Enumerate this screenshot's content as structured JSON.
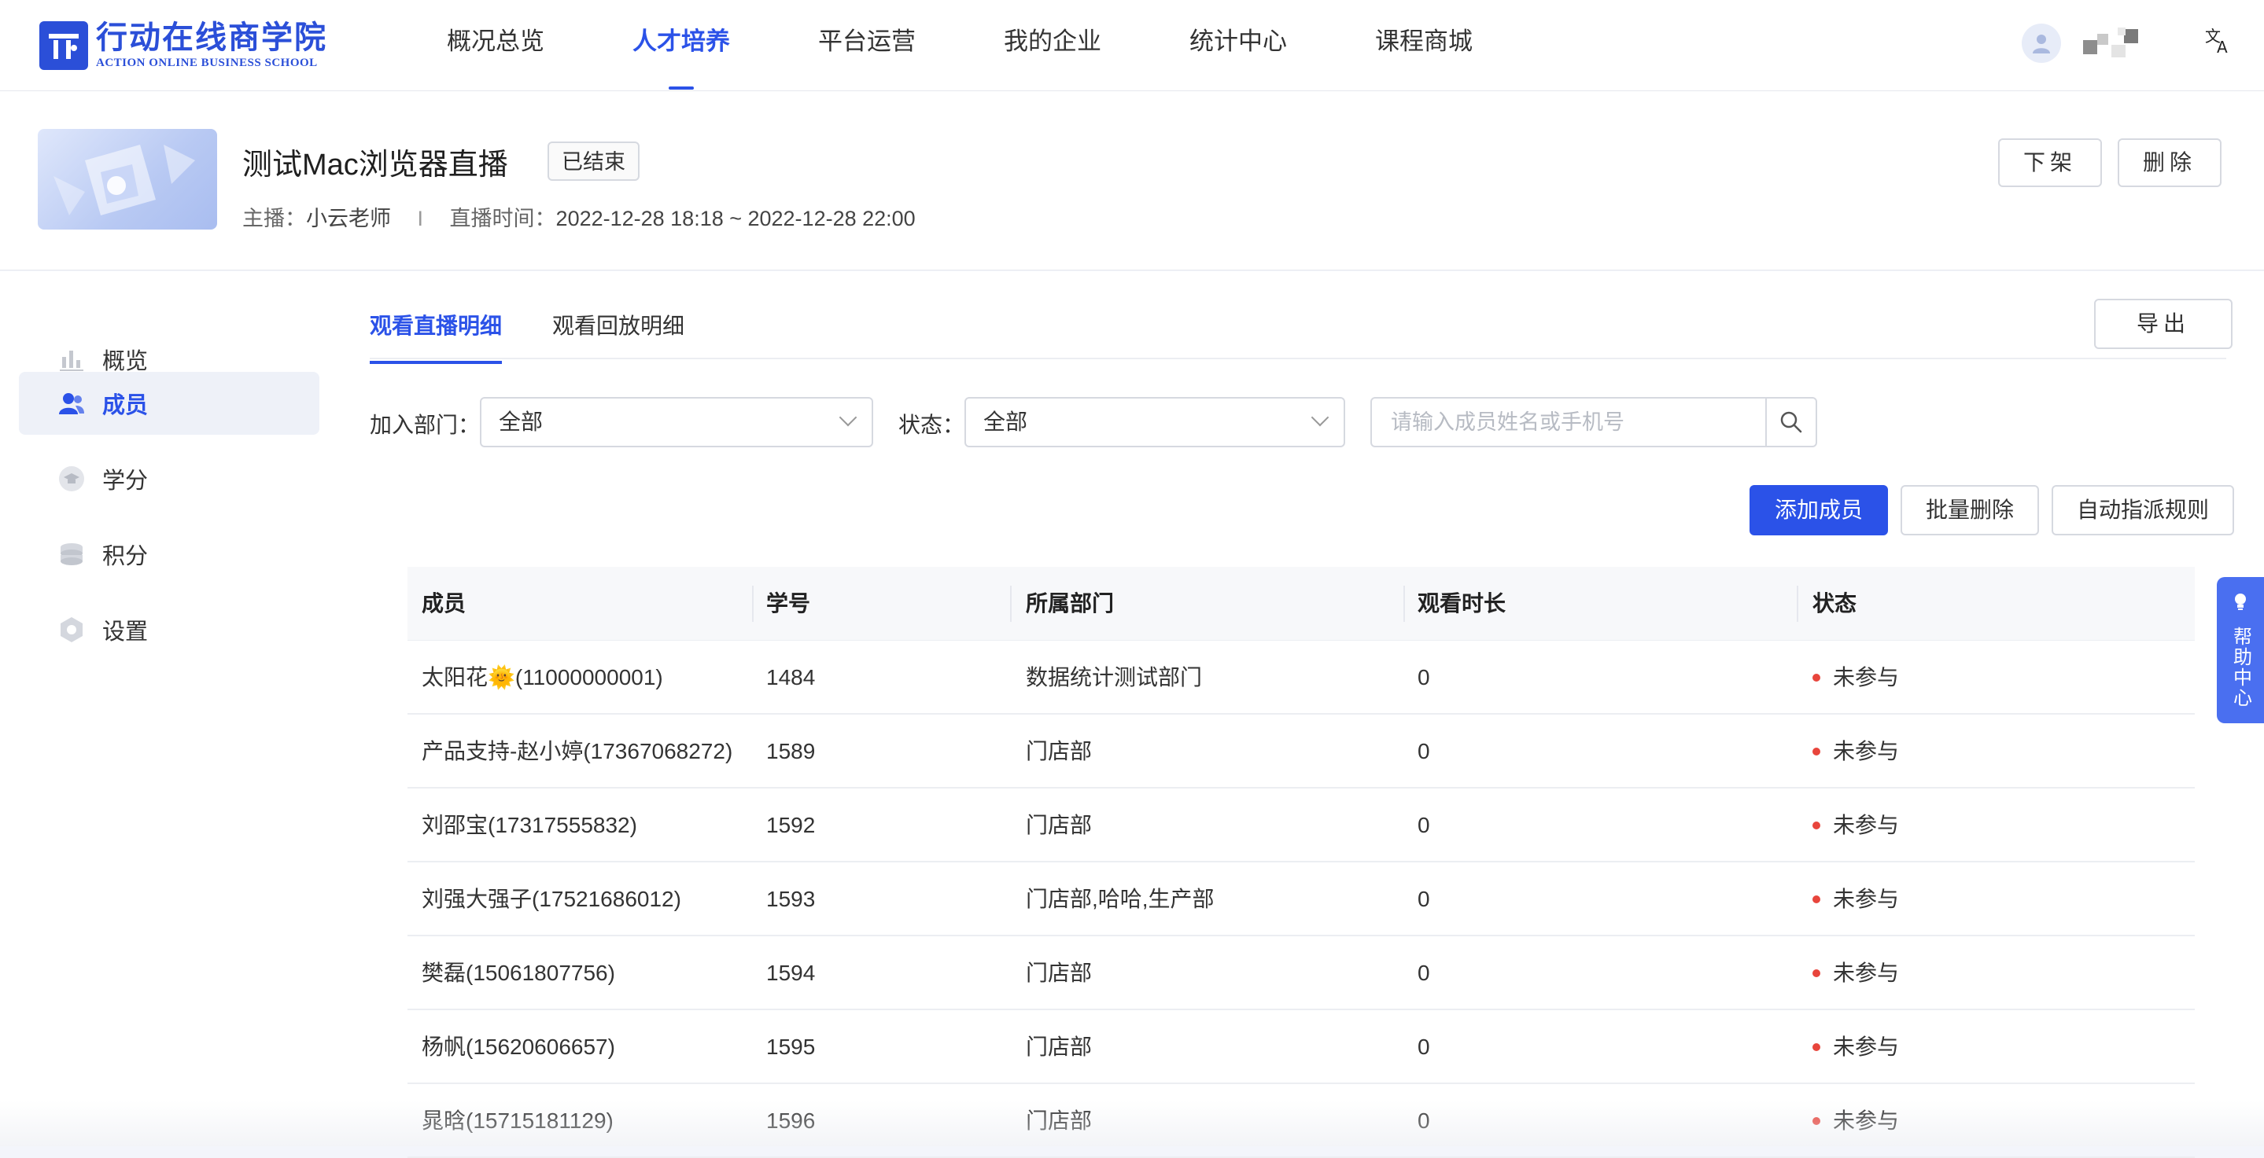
{
  "brand": {
    "name_cn": "行动在线商学院",
    "name_en": "ACTION ONLINE BUSINESS SCHOOL",
    "accent": "#2b52e8"
  },
  "nav": {
    "items": [
      {
        "label": "概况总览",
        "active": false
      },
      {
        "label": "人才培养",
        "active": true
      },
      {
        "label": "平台运营",
        "active": false
      },
      {
        "label": "我的企业",
        "active": false
      },
      {
        "label": "统计中心",
        "active": false
      },
      {
        "label": "课程商城",
        "active": false
      }
    ],
    "language_icon": "translate-icon",
    "avatar_icon": "user-avatar-icon"
  },
  "course": {
    "title": "测试Mac浏览器直播",
    "status": "已结束",
    "host_label": "主播：",
    "host": "小云老师",
    "separator": "I",
    "time_label": "直播时间：",
    "time": "2022-12-28 18:18 ~ 2022-12-28 22:00",
    "actions": {
      "unlist": "下架",
      "delete": "删除"
    }
  },
  "sidebar": {
    "items": [
      {
        "label": "概览",
        "icon": "bar-chart-icon",
        "active": false
      },
      {
        "label": "成员",
        "icon": "users-icon",
        "active": true
      },
      {
        "label": "学分",
        "icon": "graduation-cap-icon",
        "active": false
      },
      {
        "label": "积分",
        "icon": "coins-icon",
        "active": false
      },
      {
        "label": "设置",
        "icon": "gear-icon",
        "active": false
      }
    ]
  },
  "tabs": [
    {
      "label": "观看直播明细",
      "active": true
    },
    {
      "label": "观看回放明细",
      "active": false
    }
  ],
  "export_label": "导出",
  "filters": {
    "dept_label": "加入部门：",
    "dept_value": "全部",
    "status_label": "状态：",
    "status_value": "全部",
    "search_placeholder": "请输入成员姓名或手机号"
  },
  "actions": {
    "add": "添加成员",
    "batch_delete": "批量删除",
    "auto_rules": "自动指派规则"
  },
  "table": {
    "columns": [
      "成员",
      "学号",
      "所属部门",
      "观看时长",
      "状态"
    ],
    "rows": [
      {
        "member": "太阳花🌞(11000000001)",
        "id": "1484",
        "dept": "数据统计测试部门",
        "duration": "0",
        "status": "未参与"
      },
      {
        "member": "产品支持-赵小婷(17367068272)",
        "id": "1589",
        "dept": "门店部",
        "duration": "0",
        "status": "未参与"
      },
      {
        "member": "刘邵宝(17317555832)",
        "id": "1592",
        "dept": "门店部",
        "duration": "0",
        "status": "未参与"
      },
      {
        "member": "刘强大强子(17521686012)",
        "id": "1593",
        "dept": "门店部,哈哈,生产部",
        "duration": "0",
        "status": "未参与"
      },
      {
        "member": "樊磊(15061807756)",
        "id": "1594",
        "dept": "门店部",
        "duration": "0",
        "status": "未参与"
      },
      {
        "member": "杨帆(15620606657)",
        "id": "1595",
        "dept": "门店部",
        "duration": "0",
        "status": "未参与"
      },
      {
        "member": "晁晗(15715181129)",
        "id": "1596",
        "dept": "门店部",
        "duration": "0",
        "status": "未参与"
      }
    ],
    "status_color": "#e8453c"
  },
  "help": {
    "label": "帮助中心",
    "icon": "lightbulb-icon"
  }
}
